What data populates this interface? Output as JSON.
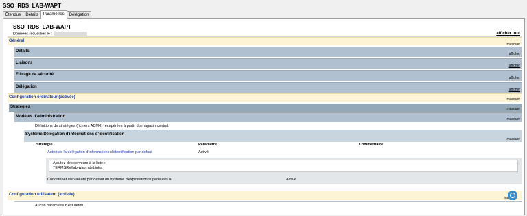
{
  "window": {
    "title": "SSO_RDS_LAB-WAPT"
  },
  "tabs": [
    "Étendue",
    "Détails",
    "Paramètres",
    "Délégation"
  ],
  "report": {
    "title": "SSO_RDS_LAB-WAPT",
    "collected_label": "Données recueillies le :",
    "show_all": "afficher tout"
  },
  "sections": {
    "general": {
      "label": "Général",
      "action": "masquer"
    },
    "details": {
      "label": "Détails",
      "action": "afficher"
    },
    "links": {
      "label": "Liaisons",
      "action": "afficher"
    },
    "security": {
      "label": "Filtrage de sécurité",
      "action": "afficher"
    },
    "delegation": {
      "label": "Délégation",
      "action": "afficher"
    },
    "computer": {
      "label": "Configuration ordinateur (activée)",
      "action": "masquer"
    },
    "strategies": {
      "label": "Stratégies",
      "action": "masquer"
    },
    "admin_templates": {
      "label": "Modèles d'administration",
      "action": "masquer"
    },
    "admin_desc": "Définitions de stratégies (fichiers ADMX) récupérées à partir du magasin central.",
    "system_deleg": {
      "label": "Système/Délégation d'informations d'identification",
      "action": "masquer"
    },
    "user": {
      "label": "Configuration utilisateur (activée)",
      "action": "masquer"
    },
    "user_desc": "Aucun paramètre n'est défini."
  },
  "policy_table": {
    "headers": {
      "strategy": "Stratégie",
      "setting": "Paramètre",
      "comment": "Commentaire"
    },
    "row": {
      "strategy": "Autoriser la délégation d'informations d'identification par défaut",
      "setting": "Activé"
    },
    "server_list_label": "Ajoutez des serveurs à la liste :",
    "server_value": "TERMSRV/lab-wapt.rdnt.intra",
    "concat_label": "Concaténer les valeurs par défaut du système d'exploitation supérieures à",
    "concat_value": "Activé"
  },
  "colors": {
    "yellow_band": "#fcf4d4",
    "blue_band": "#b0c0d0",
    "link_blue": "#2a3fc0",
    "logo": "#3a8fd0"
  }
}
